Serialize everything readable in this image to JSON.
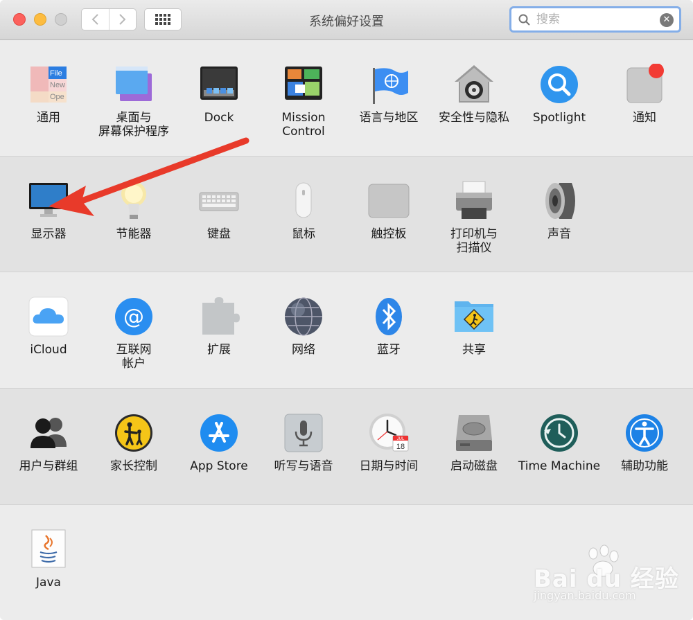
{
  "window": {
    "title": "系统偏好设置",
    "search": {
      "value": "",
      "placeholder": "搜索"
    }
  },
  "sections": [
    {
      "panes": [
        {
          "icon": "general-icon",
          "label": "通用"
        },
        {
          "icon": "desktop-screensaver-icon",
          "label": "桌面与\n屏幕保护程序"
        },
        {
          "icon": "dock-icon",
          "label": "Dock"
        },
        {
          "icon": "mission-control-icon",
          "label": "Mission\nControl"
        },
        {
          "icon": "language-region-icon",
          "label": "语言与地区"
        },
        {
          "icon": "security-privacy-icon",
          "label": "安全性与隐私"
        },
        {
          "icon": "spotlight-icon",
          "label": "Spotlight"
        },
        {
          "icon": "notifications-icon",
          "label": "通知"
        }
      ]
    },
    {
      "panes": [
        {
          "icon": "displays-icon",
          "label": "显示器"
        },
        {
          "icon": "energy-saver-icon",
          "label": "节能器"
        },
        {
          "icon": "keyboard-icon",
          "label": "键盘"
        },
        {
          "icon": "mouse-icon",
          "label": "鼠标"
        },
        {
          "icon": "trackpad-icon",
          "label": "触控板"
        },
        {
          "icon": "printers-scanners-icon",
          "label": "打印机与\n扫描仪"
        },
        {
          "icon": "sound-icon",
          "label": "声音"
        }
      ]
    },
    {
      "panes": [
        {
          "icon": "icloud-icon",
          "label": "iCloud"
        },
        {
          "icon": "internet-accounts-icon",
          "label": "互联网\n帐户"
        },
        {
          "icon": "extensions-icon",
          "label": "扩展"
        },
        {
          "icon": "network-icon",
          "label": "网络"
        },
        {
          "icon": "bluetooth-icon",
          "label": "蓝牙"
        },
        {
          "icon": "sharing-icon",
          "label": "共享"
        }
      ]
    },
    {
      "panes": [
        {
          "icon": "users-groups-icon",
          "label": "用户与群组"
        },
        {
          "icon": "parental-controls-icon",
          "label": "家长控制"
        },
        {
          "icon": "app-store-icon",
          "label": "App Store"
        },
        {
          "icon": "dictation-speech-icon",
          "label": "听写与语音"
        },
        {
          "icon": "date-time-icon",
          "label": "日期与时间"
        },
        {
          "icon": "startup-disk-icon",
          "label": "启动磁盘"
        },
        {
          "icon": "time-machine-icon",
          "label": "Time Machine"
        },
        {
          "icon": "accessibility-icon",
          "label": "辅助功能"
        }
      ]
    },
    {
      "panes": [
        {
          "icon": "java-icon",
          "label": "Java"
        }
      ]
    }
  ],
  "icon_text": {
    "general_file": "File",
    "general_new": "New",
    "general_open": "Ope",
    "calendar_month": "JUL",
    "calendar_day": "18"
  },
  "watermark": {
    "brand": "Bai du 经验",
    "url": "jingyan.baidu.com"
  },
  "colors": {
    "arrow": "#e83a2a",
    "search_focus": "#84aee8",
    "accent_blue": "#1f8cf0"
  }
}
